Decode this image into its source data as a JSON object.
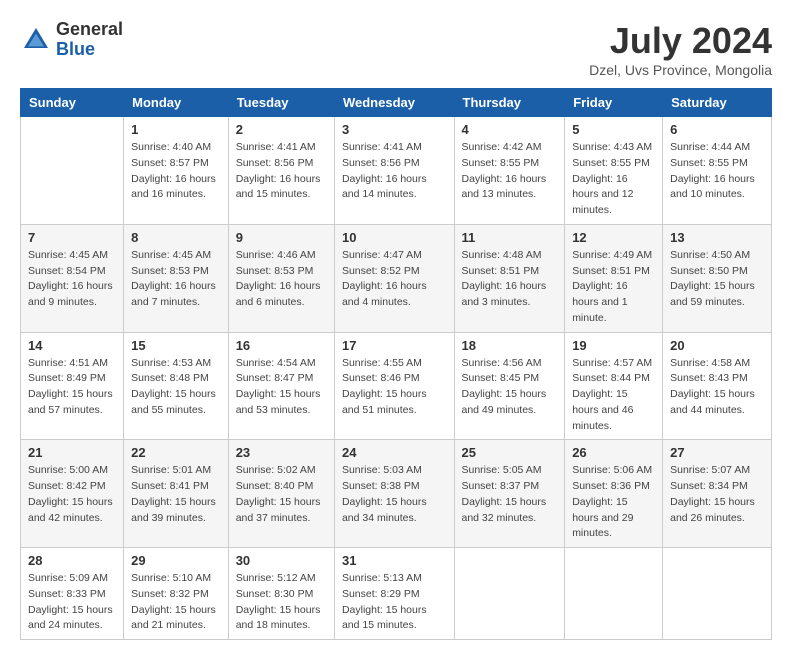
{
  "logo": {
    "general": "General",
    "blue": "Blue"
  },
  "title": {
    "month_year": "July 2024",
    "location": "Dzel, Uvs Province, Mongolia"
  },
  "calendar": {
    "headers": [
      "Sunday",
      "Monday",
      "Tuesday",
      "Wednesday",
      "Thursday",
      "Friday",
      "Saturday"
    ],
    "rows": [
      [
        {
          "day": "",
          "sunrise": "",
          "sunset": "",
          "daylight": ""
        },
        {
          "day": "1",
          "sunrise": "Sunrise: 4:40 AM",
          "sunset": "Sunset: 8:57 PM",
          "daylight": "Daylight: 16 hours and 16 minutes."
        },
        {
          "day": "2",
          "sunrise": "Sunrise: 4:41 AM",
          "sunset": "Sunset: 8:56 PM",
          "daylight": "Daylight: 16 hours and 15 minutes."
        },
        {
          "day": "3",
          "sunrise": "Sunrise: 4:41 AM",
          "sunset": "Sunset: 8:56 PM",
          "daylight": "Daylight: 16 hours and 14 minutes."
        },
        {
          "day": "4",
          "sunrise": "Sunrise: 4:42 AM",
          "sunset": "Sunset: 8:55 PM",
          "daylight": "Daylight: 16 hours and 13 minutes."
        },
        {
          "day": "5",
          "sunrise": "Sunrise: 4:43 AM",
          "sunset": "Sunset: 8:55 PM",
          "daylight": "Daylight: 16 hours and 12 minutes."
        },
        {
          "day": "6",
          "sunrise": "Sunrise: 4:44 AM",
          "sunset": "Sunset: 8:55 PM",
          "daylight": "Daylight: 16 hours and 10 minutes."
        }
      ],
      [
        {
          "day": "7",
          "sunrise": "Sunrise: 4:45 AM",
          "sunset": "Sunset: 8:54 PM",
          "daylight": "Daylight: 16 hours and 9 minutes."
        },
        {
          "day": "8",
          "sunrise": "Sunrise: 4:45 AM",
          "sunset": "Sunset: 8:53 PM",
          "daylight": "Daylight: 16 hours and 7 minutes."
        },
        {
          "day": "9",
          "sunrise": "Sunrise: 4:46 AM",
          "sunset": "Sunset: 8:53 PM",
          "daylight": "Daylight: 16 hours and 6 minutes."
        },
        {
          "day": "10",
          "sunrise": "Sunrise: 4:47 AM",
          "sunset": "Sunset: 8:52 PM",
          "daylight": "Daylight: 16 hours and 4 minutes."
        },
        {
          "day": "11",
          "sunrise": "Sunrise: 4:48 AM",
          "sunset": "Sunset: 8:51 PM",
          "daylight": "Daylight: 16 hours and 3 minutes."
        },
        {
          "day": "12",
          "sunrise": "Sunrise: 4:49 AM",
          "sunset": "Sunset: 8:51 PM",
          "daylight": "Daylight: 16 hours and 1 minute."
        },
        {
          "day": "13",
          "sunrise": "Sunrise: 4:50 AM",
          "sunset": "Sunset: 8:50 PM",
          "daylight": "Daylight: 15 hours and 59 minutes."
        }
      ],
      [
        {
          "day": "14",
          "sunrise": "Sunrise: 4:51 AM",
          "sunset": "Sunset: 8:49 PM",
          "daylight": "Daylight: 15 hours and 57 minutes."
        },
        {
          "day": "15",
          "sunrise": "Sunrise: 4:53 AM",
          "sunset": "Sunset: 8:48 PM",
          "daylight": "Daylight: 15 hours and 55 minutes."
        },
        {
          "day": "16",
          "sunrise": "Sunrise: 4:54 AM",
          "sunset": "Sunset: 8:47 PM",
          "daylight": "Daylight: 15 hours and 53 minutes."
        },
        {
          "day": "17",
          "sunrise": "Sunrise: 4:55 AM",
          "sunset": "Sunset: 8:46 PM",
          "daylight": "Daylight: 15 hours and 51 minutes."
        },
        {
          "day": "18",
          "sunrise": "Sunrise: 4:56 AM",
          "sunset": "Sunset: 8:45 PM",
          "daylight": "Daylight: 15 hours and 49 minutes."
        },
        {
          "day": "19",
          "sunrise": "Sunrise: 4:57 AM",
          "sunset": "Sunset: 8:44 PM",
          "daylight": "Daylight: 15 hours and 46 minutes."
        },
        {
          "day": "20",
          "sunrise": "Sunrise: 4:58 AM",
          "sunset": "Sunset: 8:43 PM",
          "daylight": "Daylight: 15 hours and 44 minutes."
        }
      ],
      [
        {
          "day": "21",
          "sunrise": "Sunrise: 5:00 AM",
          "sunset": "Sunset: 8:42 PM",
          "daylight": "Daylight: 15 hours and 42 minutes."
        },
        {
          "day": "22",
          "sunrise": "Sunrise: 5:01 AM",
          "sunset": "Sunset: 8:41 PM",
          "daylight": "Daylight: 15 hours and 39 minutes."
        },
        {
          "day": "23",
          "sunrise": "Sunrise: 5:02 AM",
          "sunset": "Sunset: 8:40 PM",
          "daylight": "Daylight: 15 hours and 37 minutes."
        },
        {
          "day": "24",
          "sunrise": "Sunrise: 5:03 AM",
          "sunset": "Sunset: 8:38 PM",
          "daylight": "Daylight: 15 hours and 34 minutes."
        },
        {
          "day": "25",
          "sunrise": "Sunrise: 5:05 AM",
          "sunset": "Sunset: 8:37 PM",
          "daylight": "Daylight: 15 hours and 32 minutes."
        },
        {
          "day": "26",
          "sunrise": "Sunrise: 5:06 AM",
          "sunset": "Sunset: 8:36 PM",
          "daylight": "Daylight: 15 hours and 29 minutes."
        },
        {
          "day": "27",
          "sunrise": "Sunrise: 5:07 AM",
          "sunset": "Sunset: 8:34 PM",
          "daylight": "Daylight: 15 hours and 26 minutes."
        }
      ],
      [
        {
          "day": "28",
          "sunrise": "Sunrise: 5:09 AM",
          "sunset": "Sunset: 8:33 PM",
          "daylight": "Daylight: 15 hours and 24 minutes."
        },
        {
          "day": "29",
          "sunrise": "Sunrise: 5:10 AM",
          "sunset": "Sunset: 8:32 PM",
          "daylight": "Daylight: 15 hours and 21 minutes."
        },
        {
          "day": "30",
          "sunrise": "Sunrise: 5:12 AM",
          "sunset": "Sunset: 8:30 PM",
          "daylight": "Daylight: 15 hours and 18 minutes."
        },
        {
          "day": "31",
          "sunrise": "Sunrise: 5:13 AM",
          "sunset": "Sunset: 8:29 PM",
          "daylight": "Daylight: 15 hours and 15 minutes."
        },
        {
          "day": "",
          "sunrise": "",
          "sunset": "",
          "daylight": ""
        },
        {
          "day": "",
          "sunrise": "",
          "sunset": "",
          "daylight": ""
        },
        {
          "day": "",
          "sunrise": "",
          "sunset": "",
          "daylight": ""
        }
      ]
    ]
  }
}
